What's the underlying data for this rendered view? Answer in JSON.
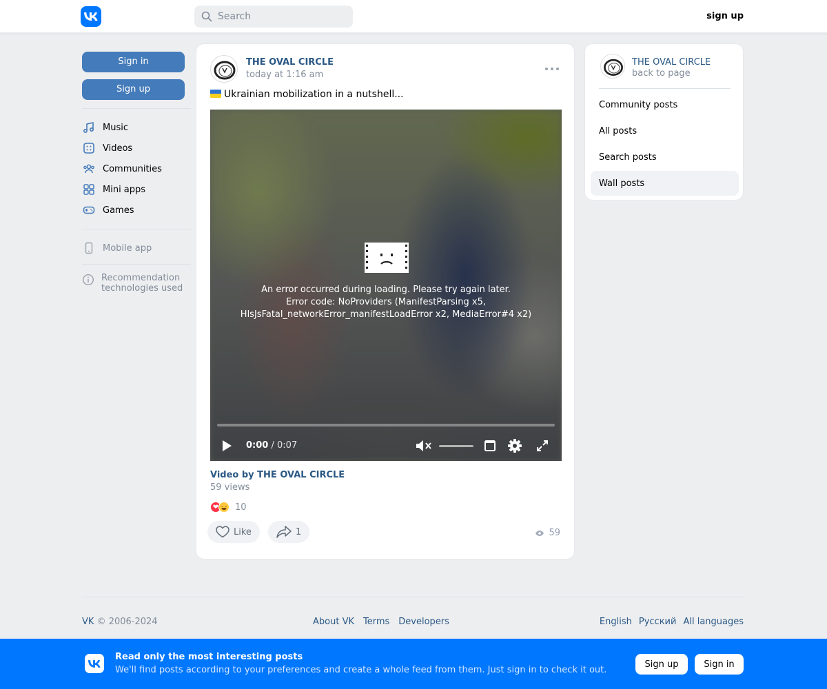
{
  "header": {
    "search_placeholder": "Search",
    "signup_link": "sign up"
  },
  "leftnav": {
    "signin_button": "Sign in",
    "signup_button": "Sign up",
    "items": [
      {
        "label": "Music",
        "icon": "music-icon"
      },
      {
        "label": "Videos",
        "icon": "video-icon"
      },
      {
        "label": "Communities",
        "icon": "users-icon"
      },
      {
        "label": "Mini apps",
        "icon": "apps-icon"
      },
      {
        "label": "Games",
        "icon": "gamepad-icon"
      }
    ],
    "mobile_app": "Mobile app",
    "recommendation": "Recommendation technologies used"
  },
  "post": {
    "author": "THE OVAL CIRCLE",
    "time": "today at 1:16 am",
    "text": "Ukrainian mobilization in a nutshell...",
    "video": {
      "error_line1": "An error occurred during loading. Please try again later.",
      "error_line2": "Error code: NoProviders (ManifestParsing x5,",
      "error_line3": "HlsJsFatal_networkError_manifestLoadError x2, MediaError#4 x2)",
      "current_time": "0:00",
      "separator": "/",
      "duration": "0:07"
    },
    "video_title": "Video by THE OVAL CIRCLE",
    "video_views": "59 views",
    "reaction_count": "10",
    "like_label": "Like",
    "share_count": "1",
    "views_count": "59"
  },
  "rpanel": {
    "name": "THE OVAL CIRCLE",
    "back": "back to page",
    "items": [
      "Community posts",
      "All posts",
      "Search posts",
      "Wall posts"
    ]
  },
  "footer": {
    "brand": "VK",
    "copyright": "© 2006-2024",
    "links": [
      "About VK",
      "Terms",
      "Developers"
    ],
    "languages": [
      "English",
      "Русский",
      "All languages"
    ]
  },
  "banner": {
    "title": "Read only the most interesting posts",
    "subtitle": "We'll find posts according to your preferences and create a whole feed from them. Just sign in to check it out.",
    "signup_button": "Sign up",
    "signin_button": "Sign in"
  },
  "colors": {
    "brand": "#0077ff",
    "link": "#2a5885",
    "button": "#447bba",
    "muted": "#818c99"
  }
}
